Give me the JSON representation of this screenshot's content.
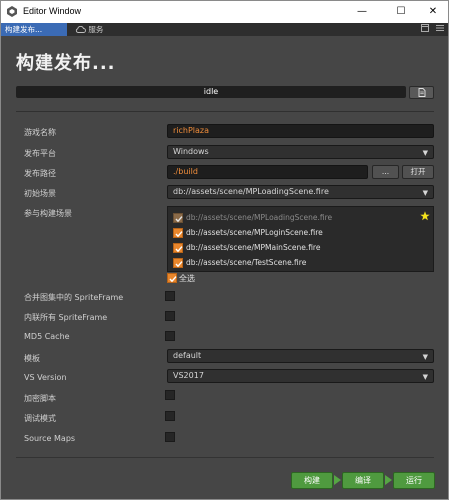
{
  "window": {
    "title": "Editor Window",
    "min": "—",
    "max": "☐",
    "close": "✕"
  },
  "tabs": [
    {
      "label": "构建发布..."
    },
    {
      "label": "服务"
    }
  ],
  "panel": {
    "heading": "构建发布...",
    "status": "idle",
    "build_progress": 0
  },
  "form": {
    "game_name": {
      "label": "游戏名称",
      "value": "richPlaza"
    },
    "platform": {
      "label": "发布平台",
      "value": "Windows"
    },
    "path": {
      "label": "发布路径",
      "value": "./build",
      "browse": "...",
      "open": "打开"
    },
    "start_scene": {
      "label": "初始场景",
      "value": "db://assets/scene/MPLoadingScene.fire"
    },
    "scenes": {
      "label": "参与构建场景",
      "items": [
        {
          "path": "db://assets/scene/MPLoadingScene.fire",
          "checked": true,
          "disabled": true
        },
        {
          "path": "db://assets/scene/MPLoginScene.fire",
          "checked": true,
          "disabled": false
        },
        {
          "path": "db://assets/scene/MPMainScene.fire",
          "checked": true,
          "disabled": false
        },
        {
          "path": "db://assets/scene/TestScene.fire",
          "checked": true,
          "disabled": false
        }
      ],
      "select_all": "全选"
    },
    "options": [
      {
        "label": "合并图集中的 SpriteFrame",
        "checked": false
      },
      {
        "label": "内联所有 SpriteFrame",
        "checked": false
      },
      {
        "label": "MD5 Cache",
        "checked": false
      }
    ],
    "template": {
      "label": "模板",
      "value": "default"
    },
    "vs_version": {
      "label": "VS Version",
      "value": "VS2017"
    },
    "options2": [
      {
        "label": "加密脚本",
        "checked": false
      },
      {
        "label": "调试模式",
        "checked": false
      },
      {
        "label": "Source Maps",
        "checked": false
      }
    ]
  },
  "actions": {
    "build": "构建",
    "compile": "编译",
    "run": "运行"
  },
  "colors": {
    "accent": "#e8862c",
    "action_green": "#4f9a3f",
    "tab_active": "#3b6bb5"
  }
}
